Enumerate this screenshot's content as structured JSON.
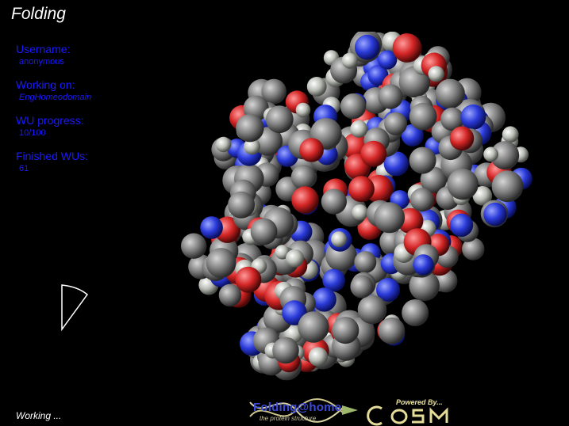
{
  "app": {
    "title": "Folding"
  },
  "info": {
    "username_label": "Username:",
    "username_value": "anonymous",
    "working_on_label": "Working on:",
    "working_on_value": "EngHomeodomain",
    "wu_progress_label": "WU progress:",
    "wu_progress_value": "10/100",
    "finished_wus_label": "Finished WUs:",
    "finished_wus_value": "61"
  },
  "status": {
    "text": "Working ..."
  },
  "logos": {
    "folding_at_home": "Folding@home",
    "folding_tagline": "the protein structure",
    "cosm_powered": "Powered By...",
    "cosm": "COSM"
  },
  "colors": {
    "background": "#000000",
    "label_blue": "#1a1aff",
    "atom_carbon": "#808080",
    "atom_oxygen": "#d02020",
    "atom_nitrogen": "#2a3ad8",
    "atom_hydrogen": "#c8c8c8"
  }
}
